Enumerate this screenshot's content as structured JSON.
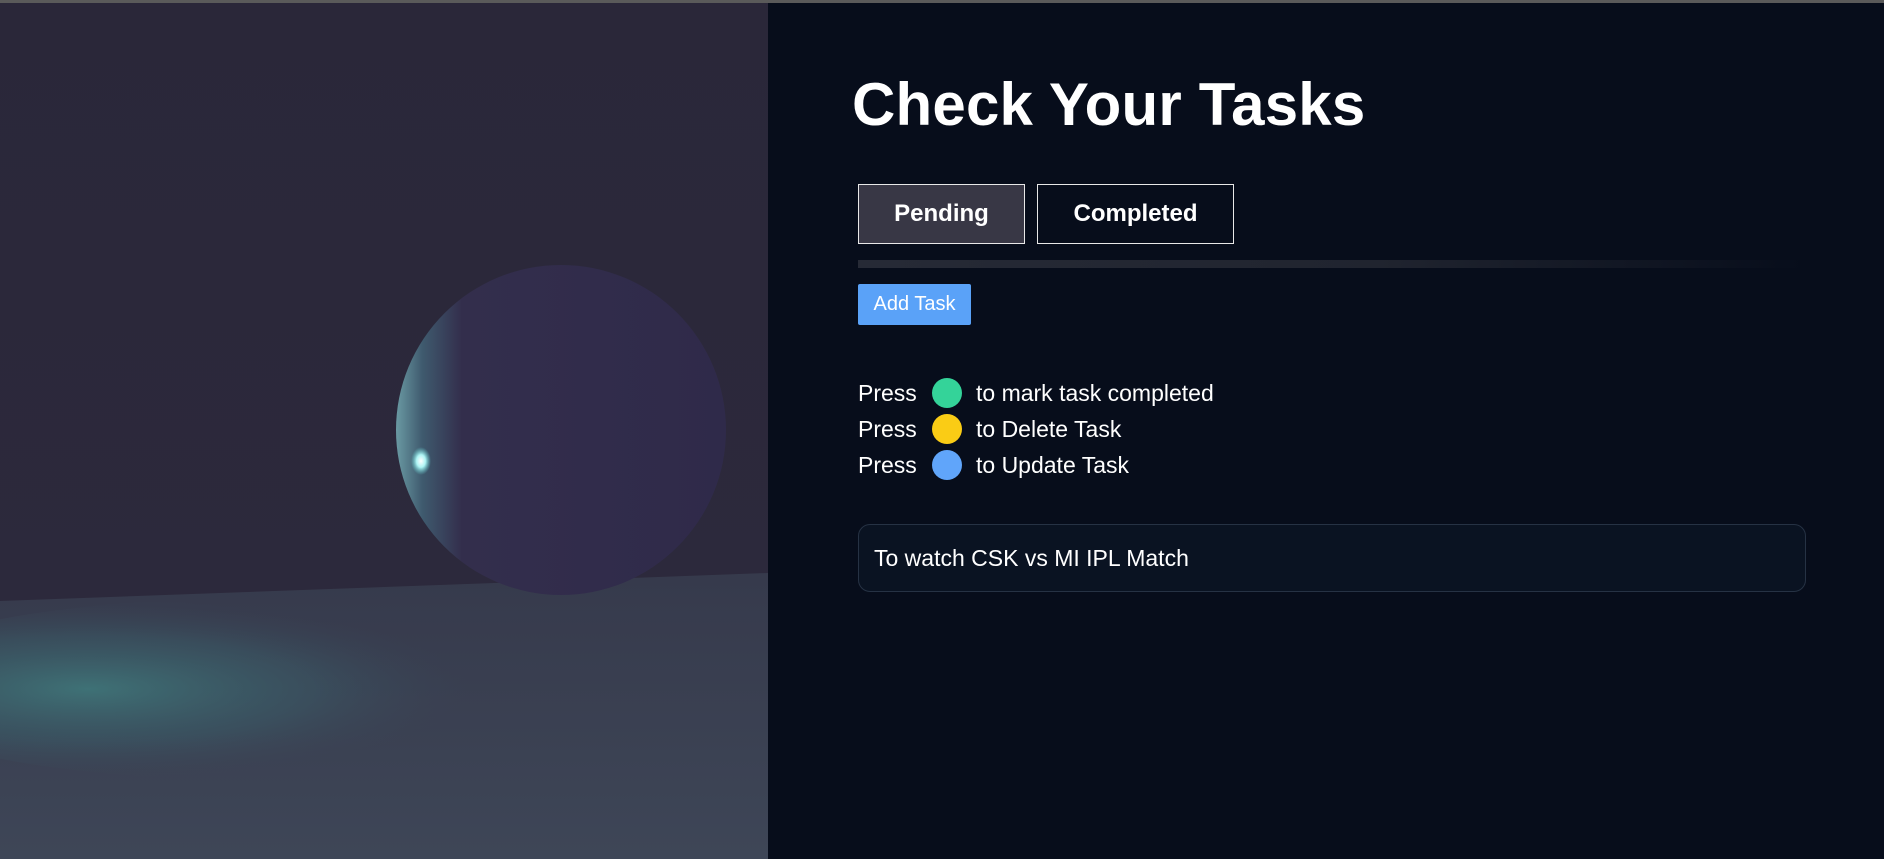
{
  "page": {
    "title": "Check Your Tasks"
  },
  "tabs": [
    {
      "label": "Pending",
      "active": true
    },
    {
      "label": "Completed",
      "active": false
    }
  ],
  "actions": {
    "add_task_label": "Add Task"
  },
  "legend": [
    {
      "press": "Press",
      "color": "#34d399",
      "icon": "green-circle-icon",
      "text": "to mark task completed"
    },
    {
      "press": "Press",
      "color": "#facc15",
      "icon": "yellow-circle-icon",
      "text": "to Delete Task"
    },
    {
      "press": "Press",
      "color": "#60a5fa",
      "icon": "blue-circle-icon",
      "text": "to Update Task"
    }
  ],
  "tasks": [
    {
      "text": "To watch CSK vs MI IPL Match"
    }
  ],
  "colors": {
    "background": "#070d1b",
    "accent": "#5aa2f8",
    "scene_wall": "#29263a",
    "scene_floor": "#3b4253",
    "sphere": "#2f2a4a"
  }
}
